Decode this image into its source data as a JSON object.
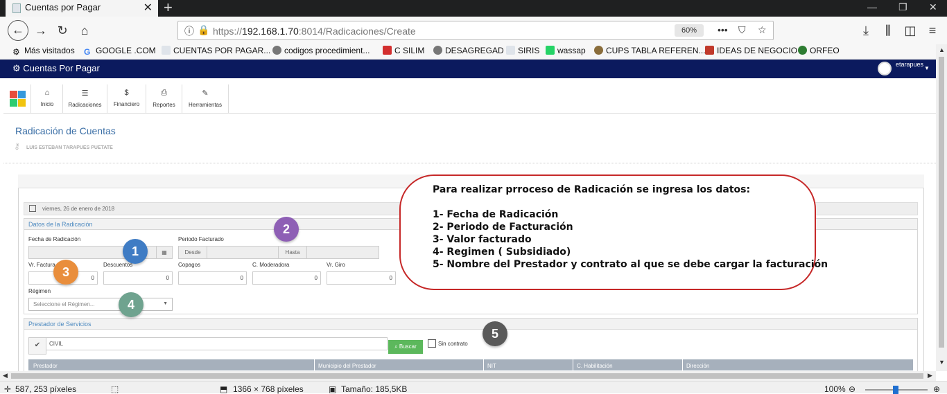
{
  "browser": {
    "tab_title": "Cuentas por Pagar",
    "url_prefix": "https://",
    "url_host": "192.168.1.70",
    "url_rest": ":8014/Radicaciones/Create",
    "zoom": "60%",
    "bookmarks": [
      "Más visitados",
      "GOOGLE .COM",
      "CUENTAS POR PAGAR...",
      "codigos procedimient...",
      "C SILIM",
      "DESAGREGAD",
      "SIRIS",
      "wassap",
      "CUPS TABLA REFEREN...",
      "IDEAS DE NEGOCIO",
      "ORFEO"
    ]
  },
  "app": {
    "title": "Cuentas Por Pagar",
    "user": "etarapues",
    "toolbar": [
      "Inicio",
      "Radicaciones",
      "Financiero",
      "Reportes",
      "Herramientas"
    ],
    "page_title": "Radicación de Cuentas",
    "page_subtitle": "LUIS ESTEBAN TARAPUES PUETATE",
    "date": "viernes, 26 de enero de 2018"
  },
  "radicacion": {
    "section_title": "Datos de la Radicación",
    "fecha_label": "Fecha de Radicación",
    "periodo_label": "Periodo Facturado",
    "desde": "Desde",
    "hasta": "Hasta",
    "vr_facturado_label": "Vr. Factura",
    "descuentos_label": "Descuentos",
    "copagos_label": "Copagos",
    "moderadora_label": "C. Moderadora",
    "giro_label": "Vr. Giro",
    "vr_facturado": "0",
    "descuentos": "0",
    "copagos": "0",
    "moderadora": "0",
    "giro": "0",
    "regimen_label": "Régimen",
    "regimen_placeholder": "Seleccione el Régimen..."
  },
  "prestador": {
    "section_title": "Prestador de Servicios",
    "search_value": "CIVIL",
    "buscar": "Buscar",
    "sin_contrato": "Sin contrato",
    "columns": [
      "Prestador",
      "Municipio del Prestador",
      "NIT",
      "C. Habilitación",
      "Dirección"
    ]
  },
  "badges": [
    "1",
    "2",
    "3",
    "4",
    "5"
  ],
  "callout": {
    "lines": [
      "Para realizar prroceso de Radicación se ingresa los datos:",
      "",
      "1- Fecha de Radicación",
      "2- Periodo de Facturación",
      "3- Valor facturado",
      "4- Regimen  ( Subsidiado)",
      "5- Nombre del Prestador  y contrato al que se debe cargar la facturación"
    ]
  },
  "status": {
    "cursor": "587, 253 píxeles",
    "dimensions": "1366 × 768 píxeles",
    "size": "Tamaño: 185,5KB",
    "zoom": "100%"
  },
  "colors": {
    "header": "#0b1a5e",
    "badge1": "#3f7cc4",
    "badge2": "#8e5fb5",
    "badge3": "#e98e3c",
    "badge4": "#6fa38f",
    "badge5": "#5a5a5a",
    "callout_border": "#c62828"
  }
}
